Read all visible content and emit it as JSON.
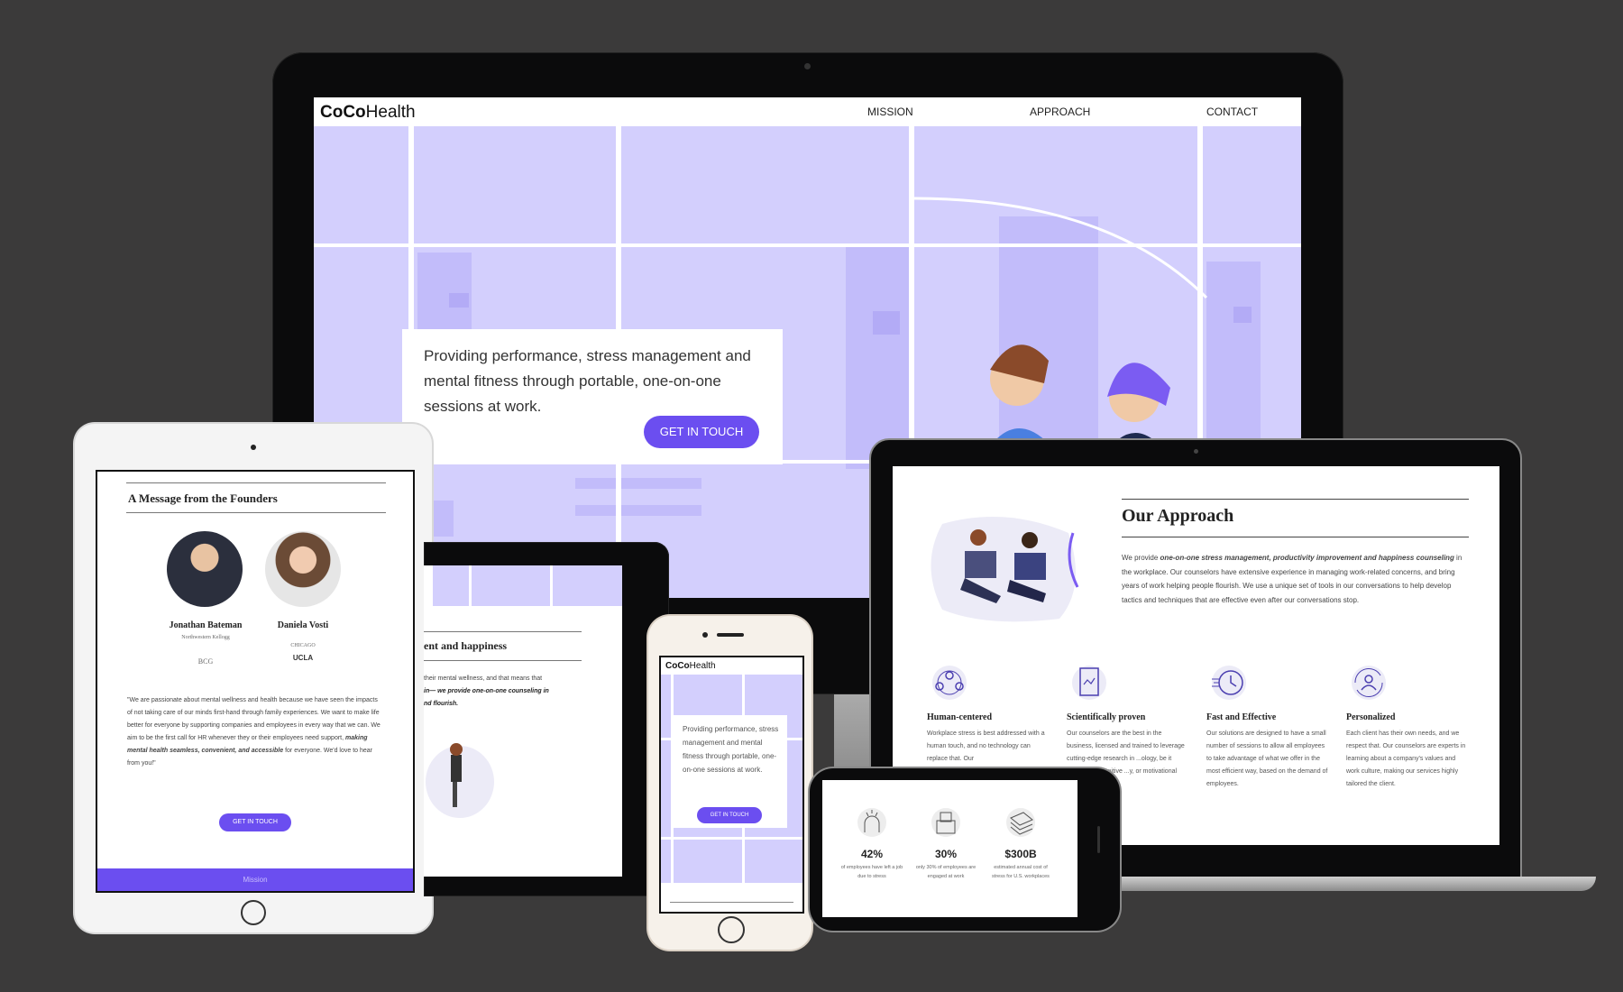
{
  "desktop": {
    "logo_bold": "CoCo",
    "logo_rest": "Health",
    "nav": [
      "MISSION",
      "APPROACH",
      "CONTACT"
    ],
    "hero_text": "Providing performance, stress management and mental fitness through portable, one-on-one sessions at work.",
    "cta": "GET IN TOUCH"
  },
  "tablet": {
    "title": "A Message from the Founders",
    "founders": [
      {
        "name": "Jonathan Bateman",
        "affil": "Northwestern Kellogg"
      },
      {
        "name": "Daniela Vosti",
        "affil": "CHICAGO"
      }
    ],
    "logo_bcg": "BCG",
    "logo_ucla": "UCLA",
    "quote_start": "\"We are passionate about mental wellness and health because we have seen the impacts of not taking care of our minds first-hand through family experiences. We want to make life better for everyone by supporting companies and employees in every way that we can. We aim to be the first call for HR whenever they or their employees need support, ",
    "quote_emph": "making mental health seamless, convenient, and accessible",
    "quote_end": " for everyone. We'd love to hear from you!\"",
    "cta": "GET IN TOUCH",
    "footer": "Mission"
  },
  "small_tablet": {
    "title_fragment": "ent and happiness",
    "text1": "their mental wellness, and that means that",
    "text2_emph": "in— we provide one-on-one counseling in",
    "text3_emph": "nd flourish."
  },
  "phone": {
    "logo_bold": "CoCo",
    "logo_rest": "Health",
    "hero_text": "Providing performance, stress management and mental fitness through portable, one-on-one sessions at work.",
    "cta": "GET IN TOUCH"
  },
  "laptop": {
    "title": "Our Approach",
    "intro_start": "We provide ",
    "intro_emph": "one-on-one stress management, productivity improvement and happiness counseling",
    "intro_end": " in the workplace. Our counselors have extensive experience in managing work-related concerns, and bring years of work helping people flourish. We use a unique set of tools in our conversations to help develop tactics and techniques that are effective even after our conversations stop.",
    "features": [
      {
        "icon": "people-circle-icon",
        "title": "Human-centered",
        "text": "Workplace stress is best addressed with a human touch, and no technology can replace that. Our"
      },
      {
        "icon": "clipboard-chart-icon",
        "title": "Scientifically proven",
        "text": "Our counselors are the best in the business, licensed and trained to leverage cutting-edge research in ...ology, be it solution- ...cognitive ...y, or motivational"
      },
      {
        "icon": "clock-icon",
        "title": "Fast and Effective",
        "text": "Our solutions are designed to have a small number of sessions to allow all employees to take advantage of what we offer in the most efficient way, based on the demand of employees."
      },
      {
        "icon": "person-cycle-icon",
        "title": "Personalized",
        "text": "Each client has their own needs, and we respect that. Our counselors are experts in learning about a company's values and work culture, making our services highly tailored the client."
      }
    ]
  },
  "landscape_phone": {
    "stats": [
      {
        "icon": "stressed-head-icon",
        "value": "42%",
        "caption": "of employees have left a job due to stress"
      },
      {
        "icon": "ballot-box-icon",
        "value": "30%",
        "caption": "only 30% of employees are engaged at work"
      },
      {
        "icon": "money-stack-icon",
        "value": "$300B",
        "caption": "estimated annual cost of stress for U.S. workplaces"
      }
    ]
  },
  "colors": {
    "accent": "#6b4ef0",
    "lavender": "#d3cffd",
    "lavender_dark": "#c5bff9",
    "background": "#3b3a3a"
  }
}
